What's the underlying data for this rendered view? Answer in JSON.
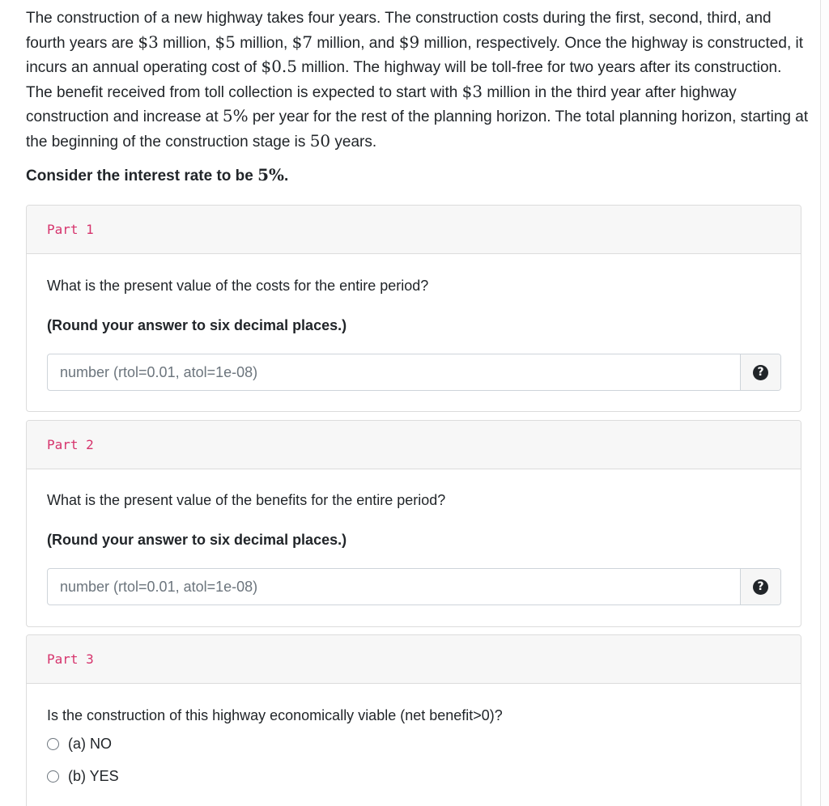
{
  "problem": {
    "t1": "The construction of a new highway takes four years. The construction costs during the first, second, third, and fourth years are ",
    "c1": "$3",
    "t2": " million, ",
    "c2": "$5",
    "t3": " million, ",
    "c3": "$7",
    "t4": " million, and ",
    "c4": "$9",
    "t5": " million, respectively. Once the highway is constructed, it incurs an annual operating cost of ",
    "op": "$0.5",
    "t6": " million. The highway will be toll-free for two years after its construction. The benefit received from toll collection is expected to start with ",
    "ben": "$3",
    "t7": " million in the third year after highway construction and increase at ",
    "growth": "5%",
    "t8": " per year for the rest of the planning horizon. The total planning horizon, starting at the beginning of the construction stage is ",
    "horizon": "50",
    "t9": " years."
  },
  "interest": {
    "label": "Consider the interest rate to be ",
    "rate": "5%",
    "period": "."
  },
  "parts": [
    {
      "header": "Part 1",
      "question": "What is the present value of the costs for the entire period?",
      "rounding": "(Round your answer to six decimal places.)",
      "placeholder": "number (rtol=0.01, atol=1e-08)",
      "help_icon": "?"
    },
    {
      "header": "Part 2",
      "question": "What is the present value of the benefits for the entire period?",
      "rounding": "(Round your answer to six decimal places.)",
      "placeholder": "number (rtol=0.01, atol=1e-08)",
      "help_icon": "?"
    },
    {
      "header": "Part 3",
      "question": "Is the construction of this highway economically viable (net benefit>0)?",
      "options": [
        "(a) NO",
        "(b) YES"
      ]
    }
  ]
}
